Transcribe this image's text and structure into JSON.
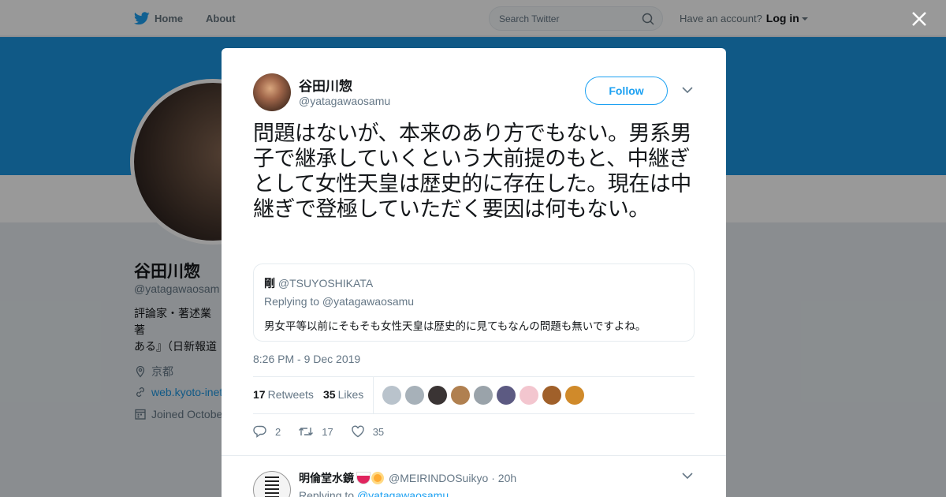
{
  "nav": {
    "home_label": "Home",
    "about_label": "About",
    "search_placeholder": "Search Twitter",
    "account_prompt": "Have an account?",
    "login_label": "Log in"
  },
  "profile": {
    "name": "谷田川惣",
    "handle": "@yatagawaosam",
    "bio": "評論家・著述業 著\nある』（日新報道\n（青林堂） 立命館",
    "location": "京都",
    "url": "web.kyoto-inet",
    "joined": "Joined October"
  },
  "tweet": {
    "author_name": "谷田川惣",
    "author_handle": "@yatagawaosamu",
    "follow_label": "Follow",
    "text": "問題はないが、本来のあり方でもない。男系男子で継承していくという大前提のもと、中継ぎとして女性天皇は歴史的に存在した。現在は中継ぎで登極していただく要因は何もない。",
    "timestamp": "8:26 PM - 9 Dec 2019",
    "retweets_count": "17",
    "retweets_label": "Retweets",
    "likes_count": "35",
    "likes_label": "Likes",
    "replies_action_count": "2",
    "retweets_action_count": "17",
    "likes_action_count": "35"
  },
  "quoted": {
    "name": "剛",
    "handle": "@TSUYOSHIKATA",
    "replying_to": "Replying to @yatagawaosamu",
    "text": "男女平等以前にそもそも女性天皇は歴史的に見てもなんの問題も無いですよね。"
  },
  "likers": [
    {
      "color": "#b9c3cc"
    },
    {
      "color": "#a7b1b9"
    },
    {
      "color": "#3a3434"
    },
    {
      "color": "#b08050"
    },
    {
      "color": "#9aa3aa"
    },
    {
      "color": "#5c5a82"
    },
    {
      "color": "#f3c6cf"
    },
    {
      "color": "#a0602a"
    },
    {
      "color": "#d08a2a"
    }
  ],
  "reply": {
    "name": "明倫堂水鏡",
    "handle": "@MEIRINDOSuikyo",
    "time": "· 20h",
    "replying_prefix": "Replying to",
    "replying_handle": "@yatagawaosamu"
  },
  "colors": {
    "brand": "#1da1f2",
    "banner": "#1b95e0"
  }
}
